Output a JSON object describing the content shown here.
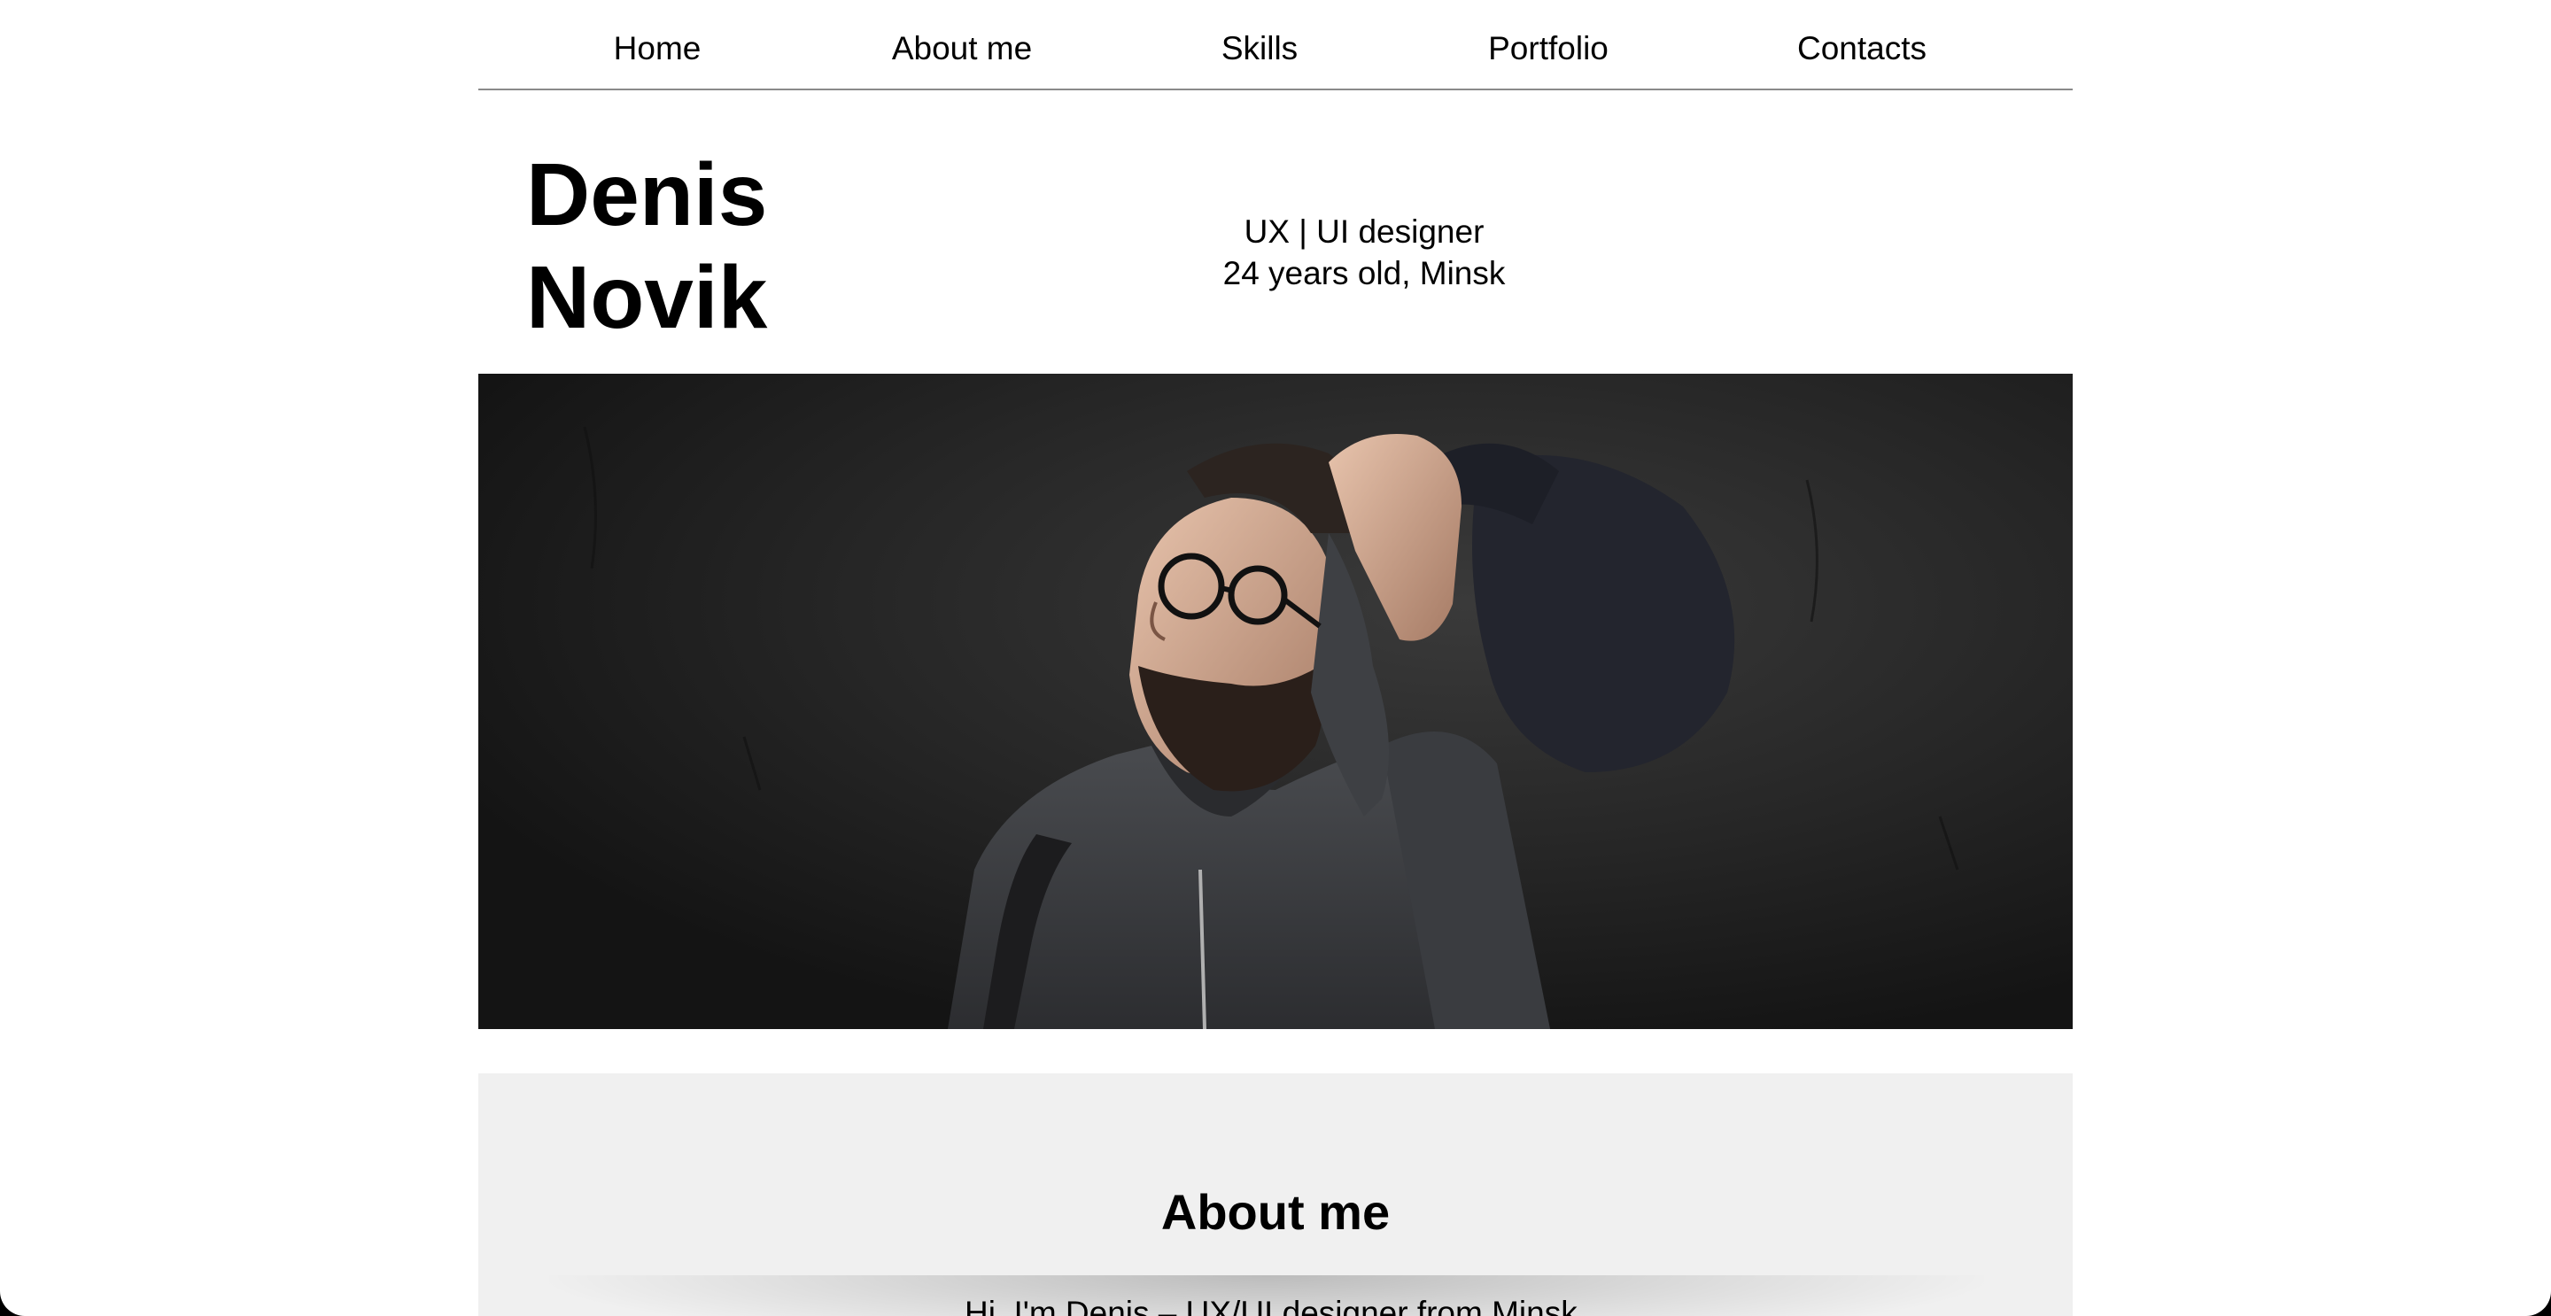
{
  "nav": {
    "items": [
      {
        "label": "Home"
      },
      {
        "label": "About me"
      },
      {
        "label": "Skills"
      },
      {
        "label": "Portfolio"
      },
      {
        "label": "Contacts"
      }
    ]
  },
  "hero": {
    "first_name": "Denis",
    "last_name": "Novik",
    "role": "UX | UI designer",
    "details": "24 years old, Minsk"
  },
  "about": {
    "title": "About me",
    "text": "Hi, I'm Denis – UX/UI designer from Minsk."
  },
  "colors": {
    "page_background": "#ffffff",
    "text": "#000000",
    "nav_divider": "#8a8a8a",
    "about_background": "#f0f0f0",
    "photo_wall": "#1f1f1f"
  }
}
